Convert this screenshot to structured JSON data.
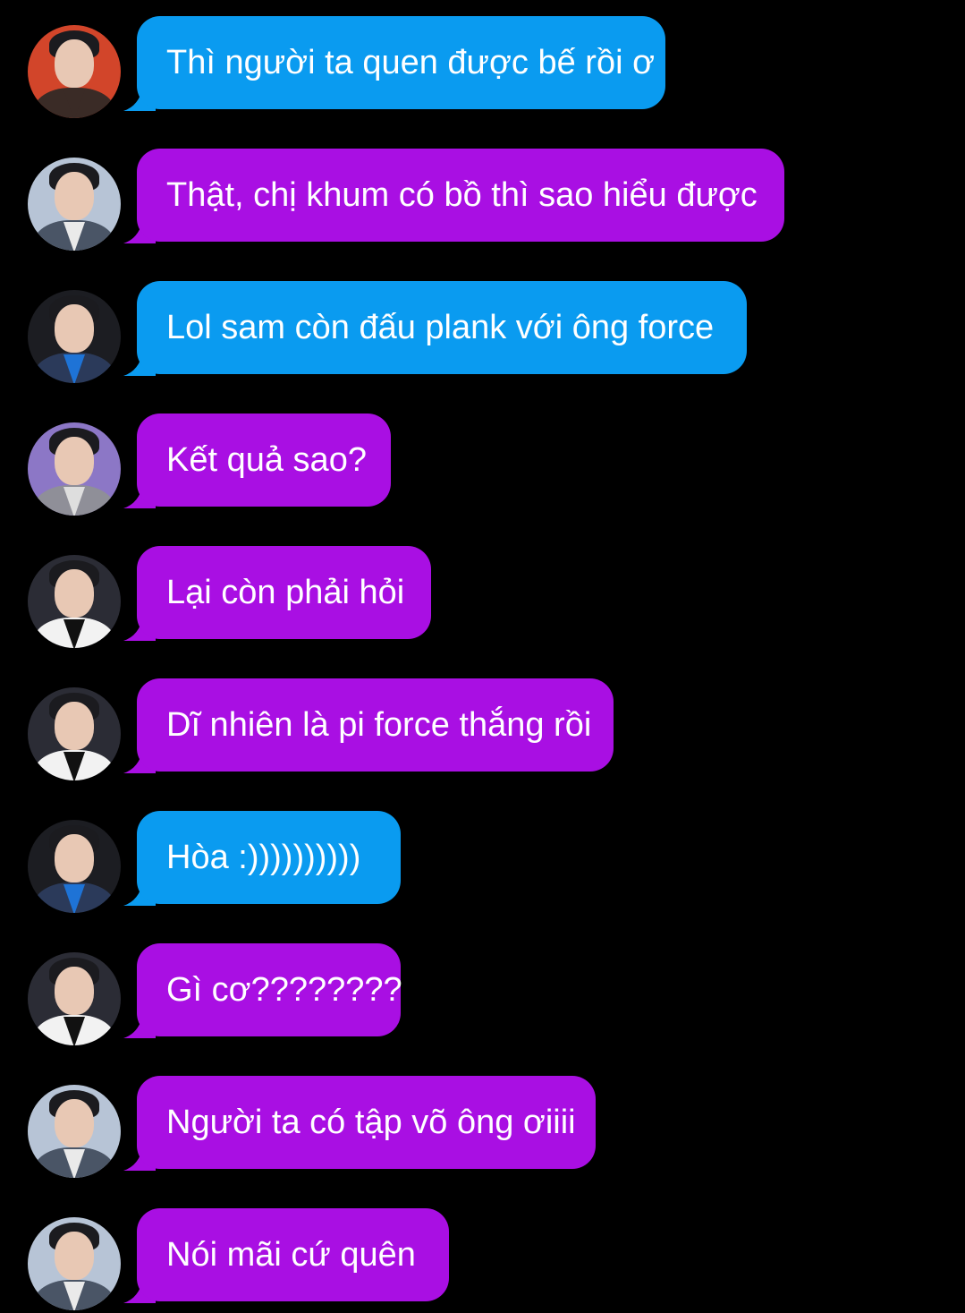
{
  "colors": {
    "background": "#000000",
    "blue_bubble": "#0a9bf0",
    "purple_bubble": "#a90fe3",
    "text": "#ffffff"
  },
  "messages": [
    {
      "text": "Thì người ta quen được bế rồi ơ",
      "color": "blue",
      "avatar": {
        "bg": "#d2452a",
        "body": "#3a2b26",
        "collar": "#3a2b26"
      }
    },
    {
      "text": "Thật, chị khum có bồ thì sao hiểu được",
      "color": "purple",
      "avatar": {
        "bg": "#b7c4d6",
        "body": "#4a5566",
        "collar": "#eaeaea"
      }
    },
    {
      "text": "Lol sam còn đấu plank với ông force",
      "color": "blue",
      "avatar": {
        "bg": "#1c1d22",
        "body": "#2b3a5a",
        "collar": "#1e73d6"
      }
    },
    {
      "text": "Kết quả sao?",
      "color": "purple",
      "avatar": {
        "bg": "#8c77c6",
        "body": "#8f8f98",
        "collar": "#dedede"
      }
    },
    {
      "text": "Lại còn phải hỏi",
      "color": "purple",
      "avatar": {
        "bg": "#2b2c35",
        "body": "#f2f2f2",
        "collar": "#111111"
      }
    },
    {
      "text": "Dĩ nhiên là pi force thắng rồi",
      "color": "purple",
      "avatar": {
        "bg": "#2b2c35",
        "body": "#f2f2f2",
        "collar": "#111111"
      }
    },
    {
      "text": "Hòa :))))))))))",
      "color": "blue",
      "avatar": {
        "bg": "#1c1d22",
        "body": "#2b3a5a",
        "collar": "#1e73d6"
      }
    },
    {
      "text": "Gì cơ????????",
      "color": "purple",
      "avatar": {
        "bg": "#2b2c35",
        "body": "#f2f2f2",
        "collar": "#111111"
      }
    },
    {
      "text": "Người ta có tập võ ông ơiiii",
      "color": "purple",
      "avatar": {
        "bg": "#b7c4d6",
        "body": "#4a5566",
        "collar": "#eaeaea"
      }
    },
    {
      "text": "Nói mãi cứ quên",
      "color": "purple",
      "avatar": {
        "bg": "#b7c4d6",
        "body": "#4a5566",
        "collar": "#eaeaea"
      }
    }
  ]
}
